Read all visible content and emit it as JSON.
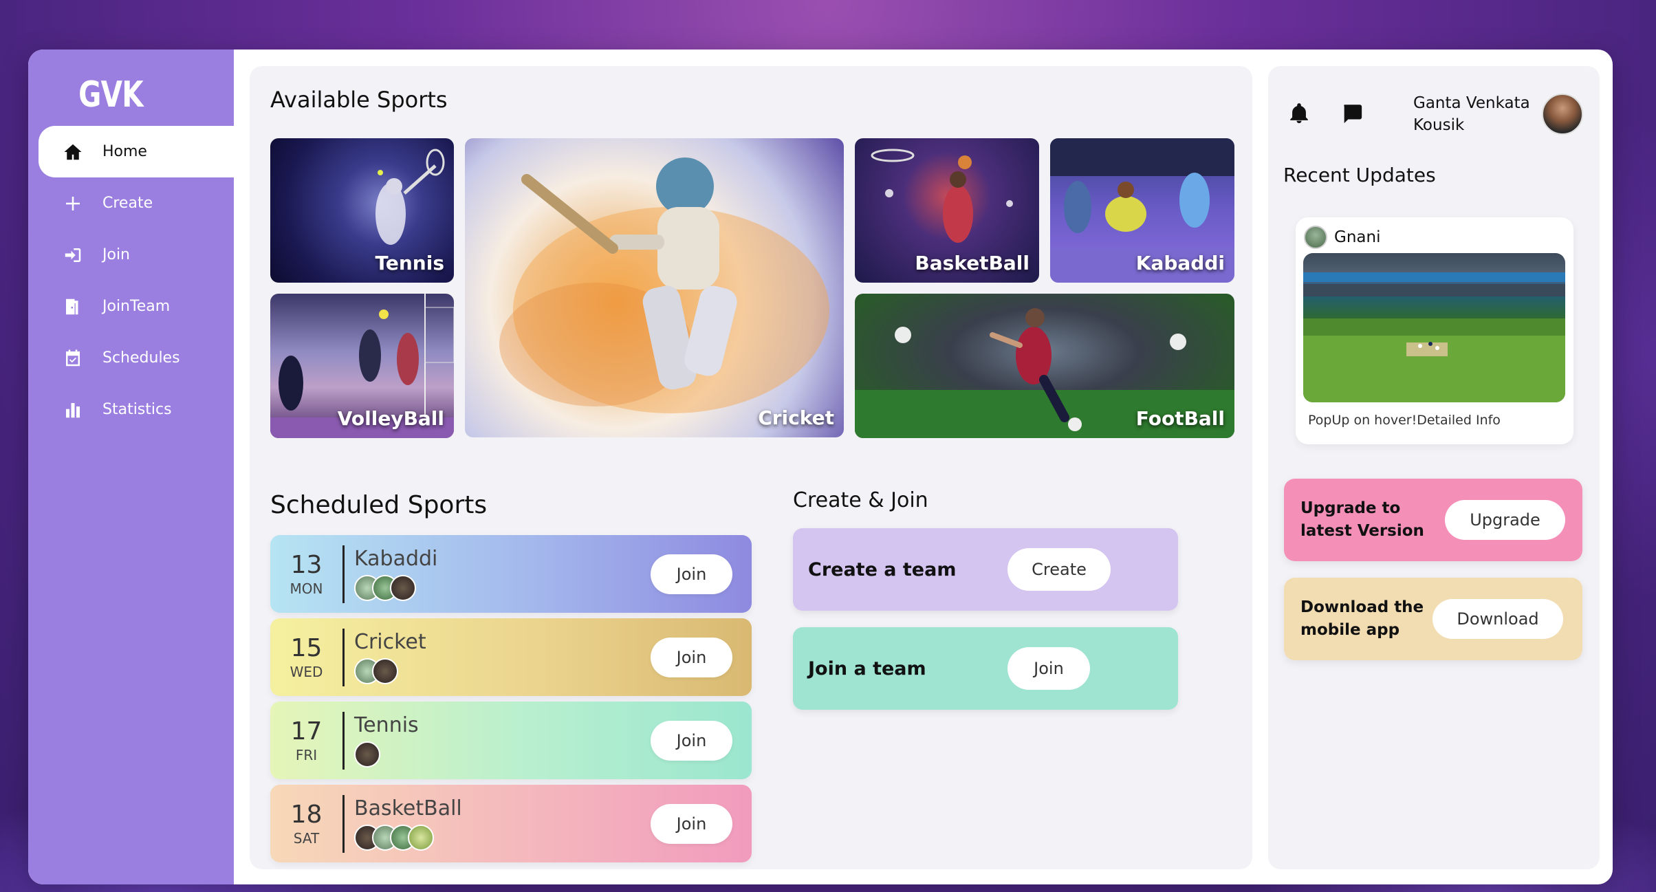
{
  "brand": {
    "logo": "GVK"
  },
  "sidebar": {
    "items": [
      {
        "label": "Home",
        "icon": "home-icon"
      },
      {
        "label": "Create",
        "icon": "plus-icon"
      },
      {
        "label": "Join",
        "icon": "login-icon"
      },
      {
        "label": "JoinTeam",
        "icon": "door-icon"
      },
      {
        "label": "Schedules",
        "icon": "calendar-icon"
      },
      {
        "label": "Statistics",
        "icon": "bar-chart-icon"
      }
    ],
    "active": "Home"
  },
  "available_sports": {
    "title": "Available Sports",
    "cards": [
      "Tennis",
      "Cricket",
      "BasketBall",
      "Kabaddi",
      "VolleyBall",
      "FootBall"
    ]
  },
  "scheduled_sports": {
    "title": "Scheduled Sports",
    "rows": [
      {
        "date": "13",
        "day": "MON",
        "name": "Kabaddi",
        "participants": 3,
        "button": "Join"
      },
      {
        "date": "15",
        "day": "WED",
        "name": "Cricket",
        "participants": 2,
        "button": "Join"
      },
      {
        "date": "17",
        "day": "FRI",
        "name": "Tennis",
        "participants": 1,
        "button": "Join"
      },
      {
        "date": "18",
        "day": "SAT",
        "name": "BasketBall",
        "participants": 4,
        "button": "Join"
      }
    ]
  },
  "create_join": {
    "title": "Create & Join",
    "create": {
      "label": "Create a team",
      "button": "Create"
    },
    "join": {
      "label": "Join a team",
      "button": "Join"
    }
  },
  "header": {
    "user_name": "Ganta Venkata Kousik",
    "notification_icon": "bell-icon",
    "message_icon": "chat-icon"
  },
  "recent_updates": {
    "title": "Recent Updates",
    "post": {
      "author": "Gnani",
      "caption": "PopUp on hover!Detailed Info"
    }
  },
  "promos": {
    "upgrade": {
      "text": "Upgrade to latest Version",
      "button": "Upgrade"
    },
    "download": {
      "text": "Download the mobile app",
      "button": "Download"
    }
  },
  "colors": {
    "sidebar": "#9b7fe0",
    "panel": "#f3f3f7",
    "upgrade_bg": "#f48fb8",
    "download_bg": "#f2dcb2",
    "create_bg": "#d4c4f0",
    "join_bg": "#9fe3d1"
  }
}
